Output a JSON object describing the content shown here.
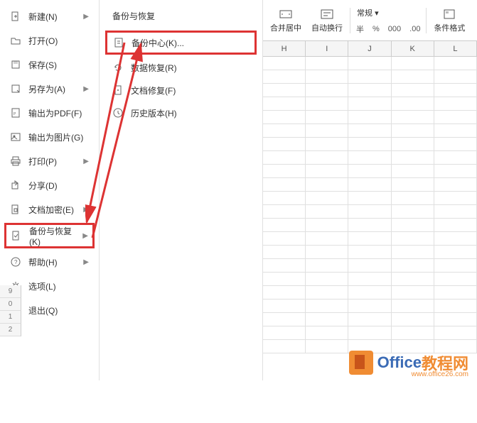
{
  "sidebar": {
    "items": [
      {
        "label": "新建(N)",
        "has_arrow": true,
        "icon": "new-file"
      },
      {
        "label": "打开(O)",
        "has_arrow": false,
        "icon": "open"
      },
      {
        "label": "保存(S)",
        "has_arrow": false,
        "icon": "save"
      },
      {
        "label": "另存为(A)",
        "has_arrow": true,
        "icon": "save-as"
      },
      {
        "label": "输出为PDF(F)",
        "has_arrow": false,
        "icon": "pdf"
      },
      {
        "label": "输出为图片(G)",
        "has_arrow": false,
        "icon": "image"
      },
      {
        "label": "打印(P)",
        "has_arrow": true,
        "icon": "print"
      },
      {
        "label": "分享(D)",
        "has_arrow": false,
        "icon": "share"
      },
      {
        "label": "文档加密(E)",
        "has_arrow": true,
        "icon": "encrypt"
      },
      {
        "label": "备份与恢复(K)",
        "has_arrow": true,
        "icon": "backup",
        "highlighted": true
      },
      {
        "label": "帮助(H)",
        "has_arrow": true,
        "icon": "help"
      },
      {
        "label": "选项(L)",
        "has_arrow": false,
        "icon": "options"
      },
      {
        "label": "退出(Q)",
        "has_arrow": false,
        "icon": "exit"
      }
    ]
  },
  "submenu": {
    "title": "备份与恢复",
    "items": [
      {
        "label": "备份中心(K)...",
        "icon": "backup-center",
        "highlighted": true
      },
      {
        "label": "数据恢复(R)",
        "icon": "recover"
      },
      {
        "label": "文档修复(F)",
        "icon": "repair"
      },
      {
        "label": "历史版本(H)",
        "icon": "history"
      }
    ]
  },
  "toolbar": {
    "merge_label": "合并居中",
    "wrap_label": "自动换行",
    "format_dropdown": "常规",
    "currency": "半",
    "percent": "%",
    "dec_inc": "000",
    "dec_dec": ".00",
    "cond_format": "条件格式"
  },
  "grid": {
    "columns": [
      "H",
      "I",
      "J",
      "K",
      "L"
    ],
    "row_numbers_bottom": [
      "9",
      "0",
      "1",
      "2"
    ]
  },
  "watermark": {
    "text1": "Office",
    "text2": "教程网",
    "url": "www.office26.com"
  }
}
